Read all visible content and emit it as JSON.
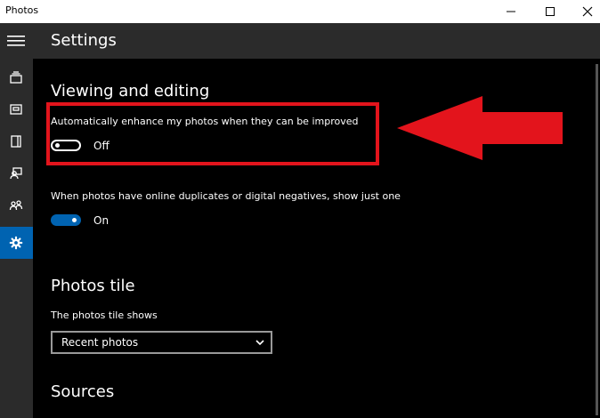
{
  "window": {
    "title": "Photos",
    "colors": {
      "accent": "#0063b1",
      "annotation": "#e3141c"
    }
  },
  "header": {
    "page_title": "Settings"
  },
  "sidebar": {
    "items": [
      {
        "icon": "collection-icon"
      },
      {
        "icon": "albums-icon"
      },
      {
        "icon": "folders-icon"
      },
      {
        "icon": "people-icon"
      },
      {
        "icon": "shared-icon"
      },
      {
        "icon": "gear-icon",
        "active": true
      }
    ]
  },
  "settings": {
    "viewing": {
      "title": "Viewing and editing",
      "auto_enhance": {
        "label": "Automatically enhance my photos when they can be improved",
        "state": "Off"
      },
      "duplicates": {
        "label": "When photos have online duplicates or digital negatives, show just one",
        "state": "On"
      }
    },
    "tile": {
      "title": "Photos tile",
      "label": "The photos tile shows",
      "selected": "Recent photos"
    },
    "sources": {
      "title": "Sources"
    }
  }
}
